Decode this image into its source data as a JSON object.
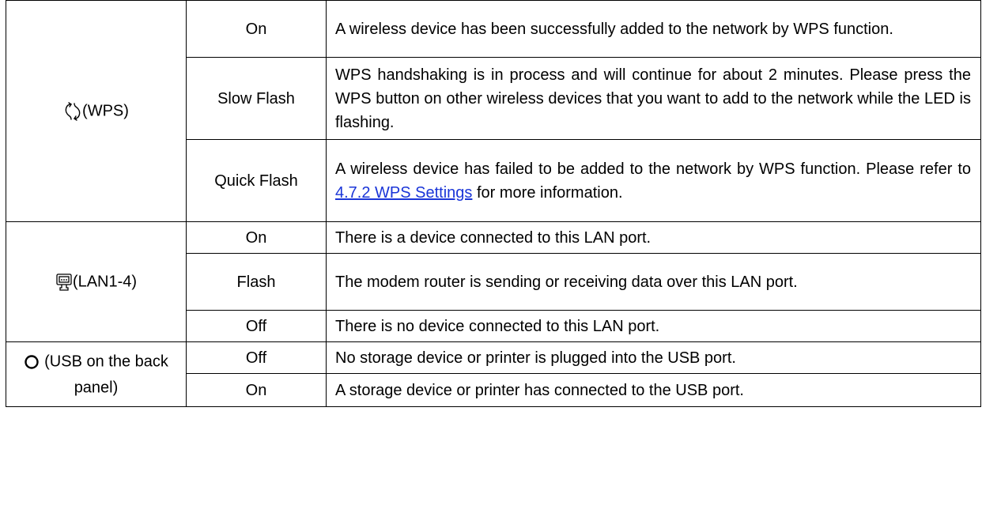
{
  "groups": [
    {
      "icon": "wps-icon",
      "label": "(WPS)",
      "rows": [
        {
          "status": "On",
          "description": "A wireless device has been successfully added to the network by WPS function."
        },
        {
          "status": "Slow Flash",
          "description": "WPS handshaking is in process and will continue for about 2 minutes. Please press the WPS button on other wireless devices that you want to add to the network while the LED is flashing."
        },
        {
          "status": "Quick Flash",
          "description_before": "A wireless device has failed to be added to the network by WPS function. Please refer to",
          "link": "4.7.2 WPS Settings",
          "description_after": "for more information."
        }
      ]
    },
    {
      "icon": "lan-icon",
      "label": "(LAN1-4)",
      "rows": [
        {
          "status": "On",
          "description": "There is a device connected to this LAN port."
        },
        {
          "status": "Flash",
          "description": "The modem router is sending or receiving data over this LAN port."
        },
        {
          "status": "Off",
          "description": "There is no device connected to this LAN port."
        }
      ]
    },
    {
      "icon": "usb-circle-icon",
      "label": "(USB on the back panel)",
      "rows": [
        {
          "status": "Off",
          "description": "No storage device or printer is plugged into the USB port."
        },
        {
          "status": "On",
          "description": "A storage device or printer has connected to the USB port."
        }
      ]
    }
  ],
  "link_color": "#1a35d8"
}
